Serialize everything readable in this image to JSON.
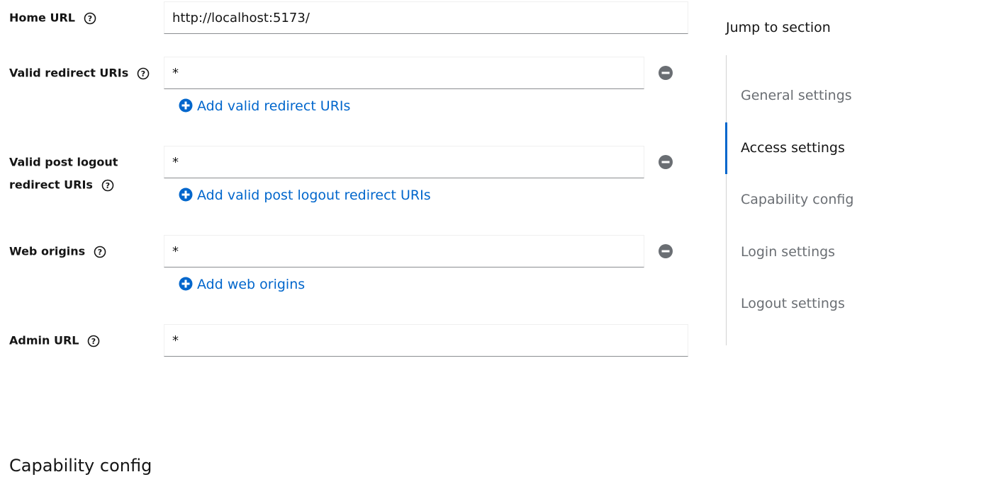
{
  "form": {
    "home_url": {
      "label": "Home URL",
      "value": "http://localhost:5173/"
    },
    "valid_redirect_uris": {
      "label": "Valid redirect URIs",
      "value": "*",
      "add_label": "Add valid redirect URIs"
    },
    "valid_post_logout": {
      "label_line1": "Valid post logout",
      "label_line2": "redirect URIs",
      "value": "*",
      "add_label": "Add valid post logout redirect URIs"
    },
    "web_origins": {
      "label": "Web origins",
      "value": "*",
      "add_label": "Add web origins"
    },
    "admin_url": {
      "label": "Admin URL",
      "value": "*"
    }
  },
  "jump": {
    "title": "Jump to section",
    "items": [
      {
        "label": "General settings",
        "active": false
      },
      {
        "label": "Access settings",
        "active": true
      },
      {
        "label": "Capability config",
        "active": false
      },
      {
        "label": "Login settings",
        "active": false
      },
      {
        "label": "Logout settings",
        "active": false
      }
    ]
  },
  "next_section": {
    "heading": "Capability config"
  },
  "colors": {
    "link": "#0066cc",
    "active_indicator": "#0066cc",
    "icon_gray": "#6a6e73"
  },
  "icons": {
    "help": "question-circle-icon",
    "remove": "minus-circle-icon",
    "add": "plus-circle-icon"
  }
}
